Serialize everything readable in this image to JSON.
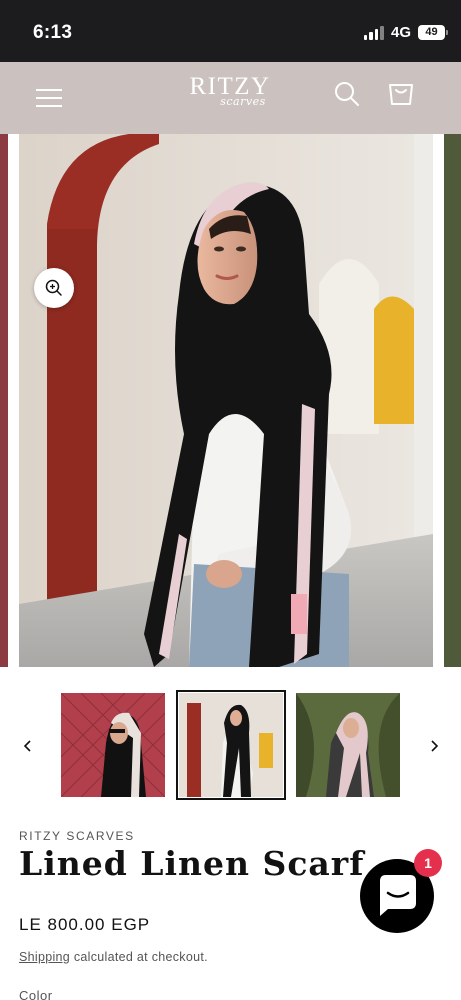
{
  "status_bar": {
    "time": "6:13",
    "network": "4G",
    "battery": "49"
  },
  "header": {
    "logo_main": "RITZY",
    "logo_sub": "scarves",
    "menu_icon": "hamburger-icon",
    "search_icon": "search-icon",
    "cart_icon": "cart-icon",
    "background_color": "#cbc2c0"
  },
  "gallery": {
    "zoom_icon": "zoom-in-icon",
    "prev_icon": "chevron-left-icon",
    "next_icon": "chevron-right-icon",
    "thumbnail_count": 3,
    "active_thumbnail": 2
  },
  "product": {
    "vendor": "RITZY SCARVES",
    "title": "Lined Linen Scarf",
    "price": "LE 800.00 EGP",
    "shipping_link": "Shipping",
    "shipping_text": " calculated at checkout.",
    "color_label": "Color"
  },
  "chat": {
    "icon": "chat-bubble-icon",
    "badge_count": "1",
    "badge_color": "#e5304d"
  }
}
